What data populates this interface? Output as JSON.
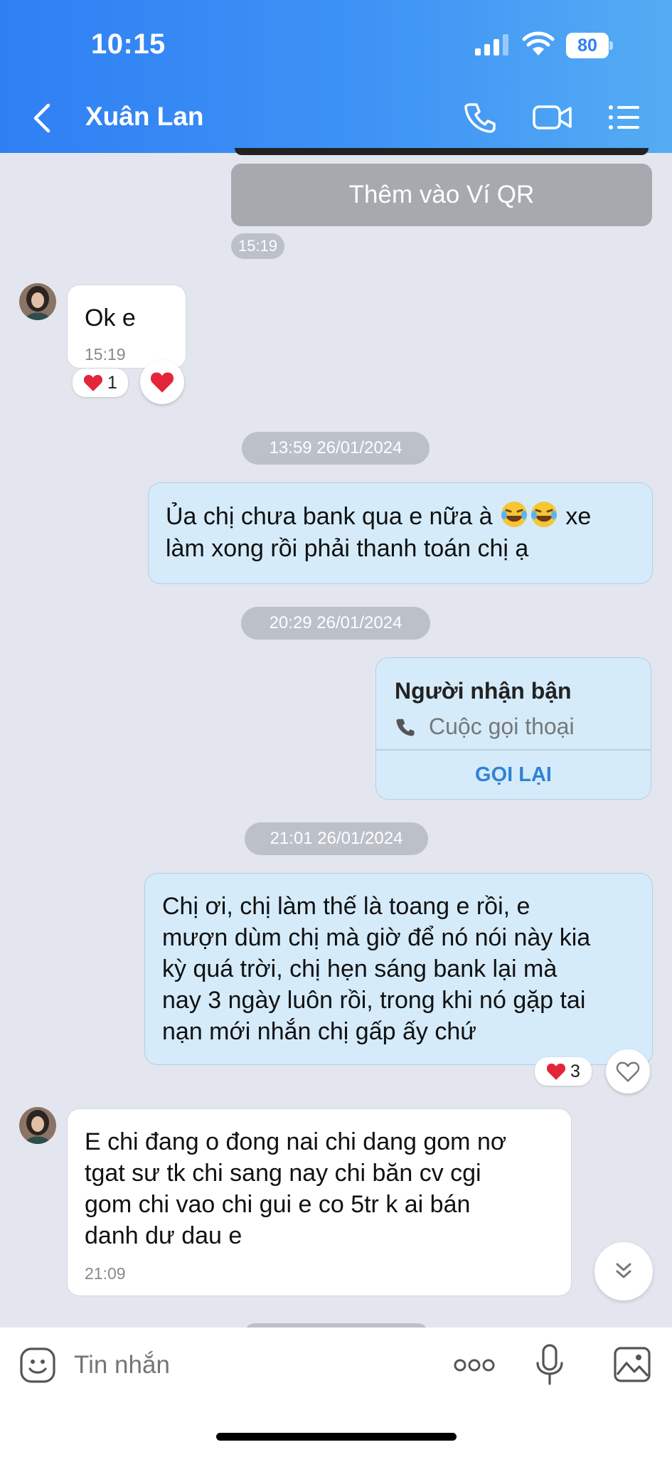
{
  "status_bar": {
    "time": "10:15",
    "battery": "80"
  },
  "header": {
    "contact_name": "Xuân Lan"
  },
  "messages": {
    "qr_button": "Thêm vào Ví QR",
    "qr_time": "15:19",
    "ok_text": "Ok e",
    "ok_time": "15:19",
    "ok_reaction_count": "1",
    "divider1": "13:59 26/01/2024",
    "msg2_line1": "Ủa chị chưa bank qua e nữa à",
    "msg2_line1_end": "xe",
    "msg2_line2": "làm xong rồi phải thanh toán chị ạ",
    "divider2": "20:29 26/01/2024",
    "call_title": "Người nhận bận",
    "call_subtitle": "Cuộc gọi thoại",
    "call_action": "GỌI LẠI",
    "divider3": "21:01 26/01/2024",
    "msg4_lines": [
      "Chị ơi, chị làm thế là toang e rồi, e",
      "mượn dùm chị mà giờ để nó nói này kia",
      "kỳ quá trời, chị hẹn sáng bank lại mà",
      "nay 3 ngày luôn rồi, trong khi nó gặp tai",
      "nạn mới nhắn chị gấp ấy chứ"
    ],
    "msg4_reaction_count": "3",
    "msg5_lines": [
      "E chi đang o đong nai chi dang gom nơ",
      "tgat sư tk chi sang nay chi băn cv cgi",
      "gom chi vao chi gui e co 5tr k ai bán",
      "danh dư dau e"
    ],
    "msg5_time": "21:09"
  },
  "composer": {
    "placeholder": "Tin nhắn"
  },
  "colors": {
    "header": "#3a8af4",
    "sent_bubble": "#d5ebfa",
    "heart": "#e3253a",
    "action_blue": "#2f83d6"
  }
}
